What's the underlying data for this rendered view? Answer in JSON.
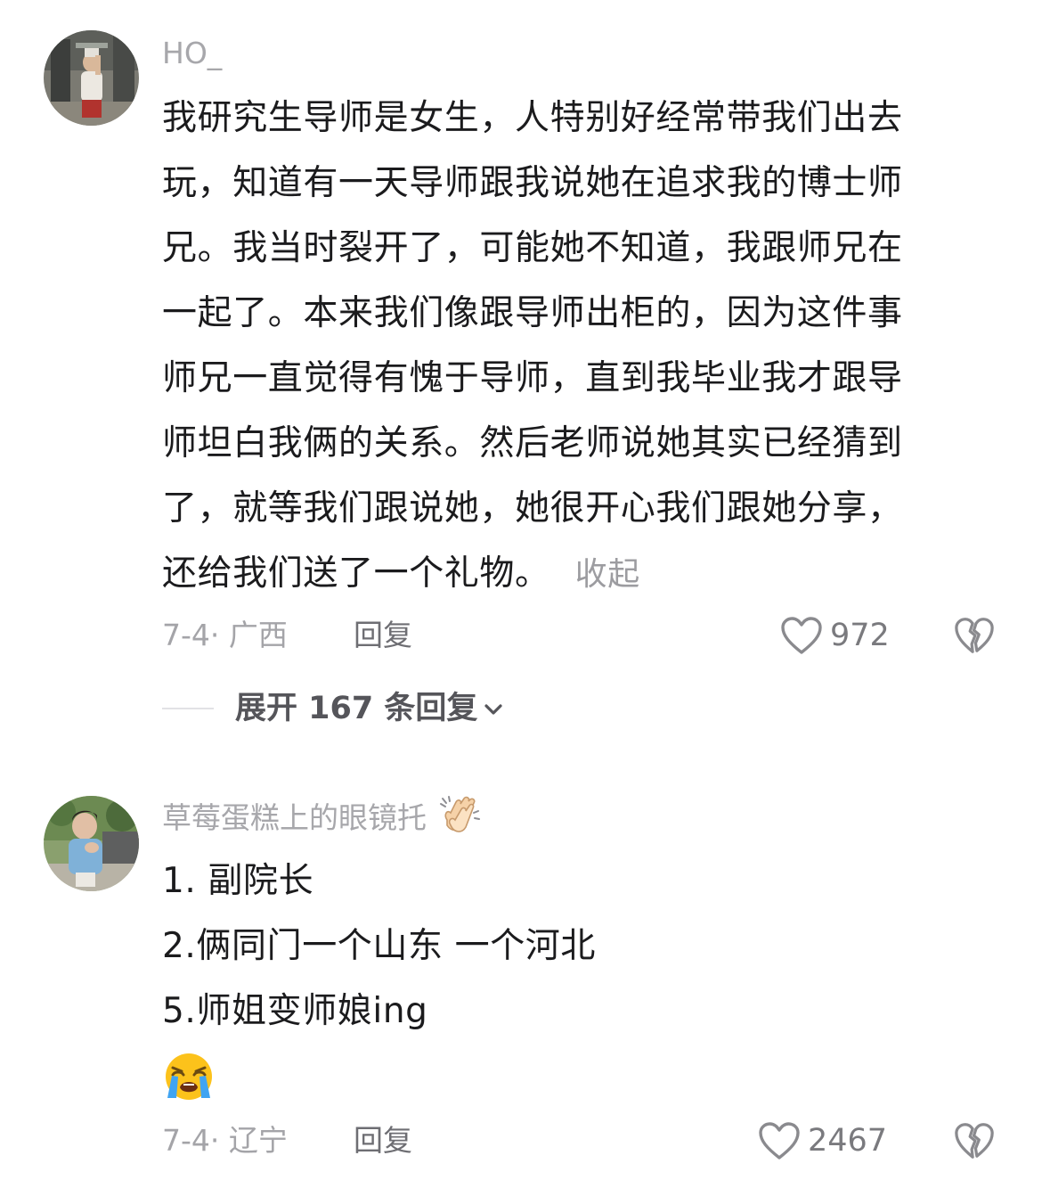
{
  "comments": [
    {
      "username": "HO_",
      "body_lines": [
        "我研究生导师是女生，人特别好经常带我们出去",
        "玩，知道有一天导师跟我说她在追求我的博士师",
        "兄。我当时裂开了，可能她不知道，我跟师兄在",
        "一起了。本来我们像跟导师出柜的，因为这件事",
        "师兄一直觉得有愧于导师，直到我毕业我才跟导",
        "师坦白我俩的关系。然后老师说她其实已经猜到",
        "了，就等我们跟说她，她很开心我们跟她分享，",
        "还给我们送了一个礼物。"
      ],
      "collapse_label": "收起",
      "date_location": "7-4· 广西",
      "reply_label": "回复",
      "like_count": "972",
      "avatar_icon": "user-avatar-gym-photo"
    },
    {
      "username": "草莓蛋糕上的眼镜托",
      "username_emoji": "clapping-hands-icon",
      "body_lines": [
        "1. 副院长",
        "2.俩同门一个山东 一个河北",
        "5.师姐变师娘ing"
      ],
      "body_emoji": "loudly-crying-face-icon",
      "date_location": "7-4· 辽宁",
      "reply_label": "回复",
      "like_count": "2467",
      "avatar_icon": "user-avatar-outdoor-photo"
    }
  ],
  "expand_replies": {
    "label": "展开 167 条回复"
  },
  "colors": {
    "username_gray": "#a7a7ab",
    "body_text": "#1b1b1d",
    "meta_gray": "#a4a4a8",
    "reply_gray": "#6e6e73",
    "like_icon": "#8a8a8e"
  }
}
